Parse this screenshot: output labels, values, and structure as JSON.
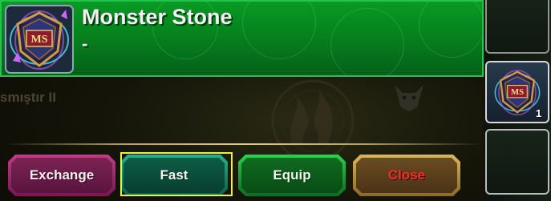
{
  "item": {
    "name": "Monster Stone",
    "subtitle": "-",
    "icon": "monster-stone-icon",
    "icon_text": "MS"
  },
  "background": {
    "partial_text": "smıştır II",
    "emblem_icon": "flame-emblem-icon",
    "demon_icon": "demon-head-icon"
  },
  "buttons": {
    "exchange": "Exchange",
    "fast": "Fast",
    "equip": "Equip",
    "close": "Close"
  },
  "inventory": {
    "slots": [
      {
        "item": "",
        "count": ""
      },
      {
        "item": "monster-stone-icon",
        "count": "1"
      },
      {
        "item": "",
        "count": ""
      }
    ]
  },
  "colors": {
    "banner_green": "#079b23",
    "exchange_button": "#7b2454",
    "fast_button": "#0d5d46",
    "equip_button": "#0e6c1f",
    "close_button": "#6a4c23",
    "close_text": "#ff2a2a",
    "selection_outline": "#eaf23a"
  }
}
